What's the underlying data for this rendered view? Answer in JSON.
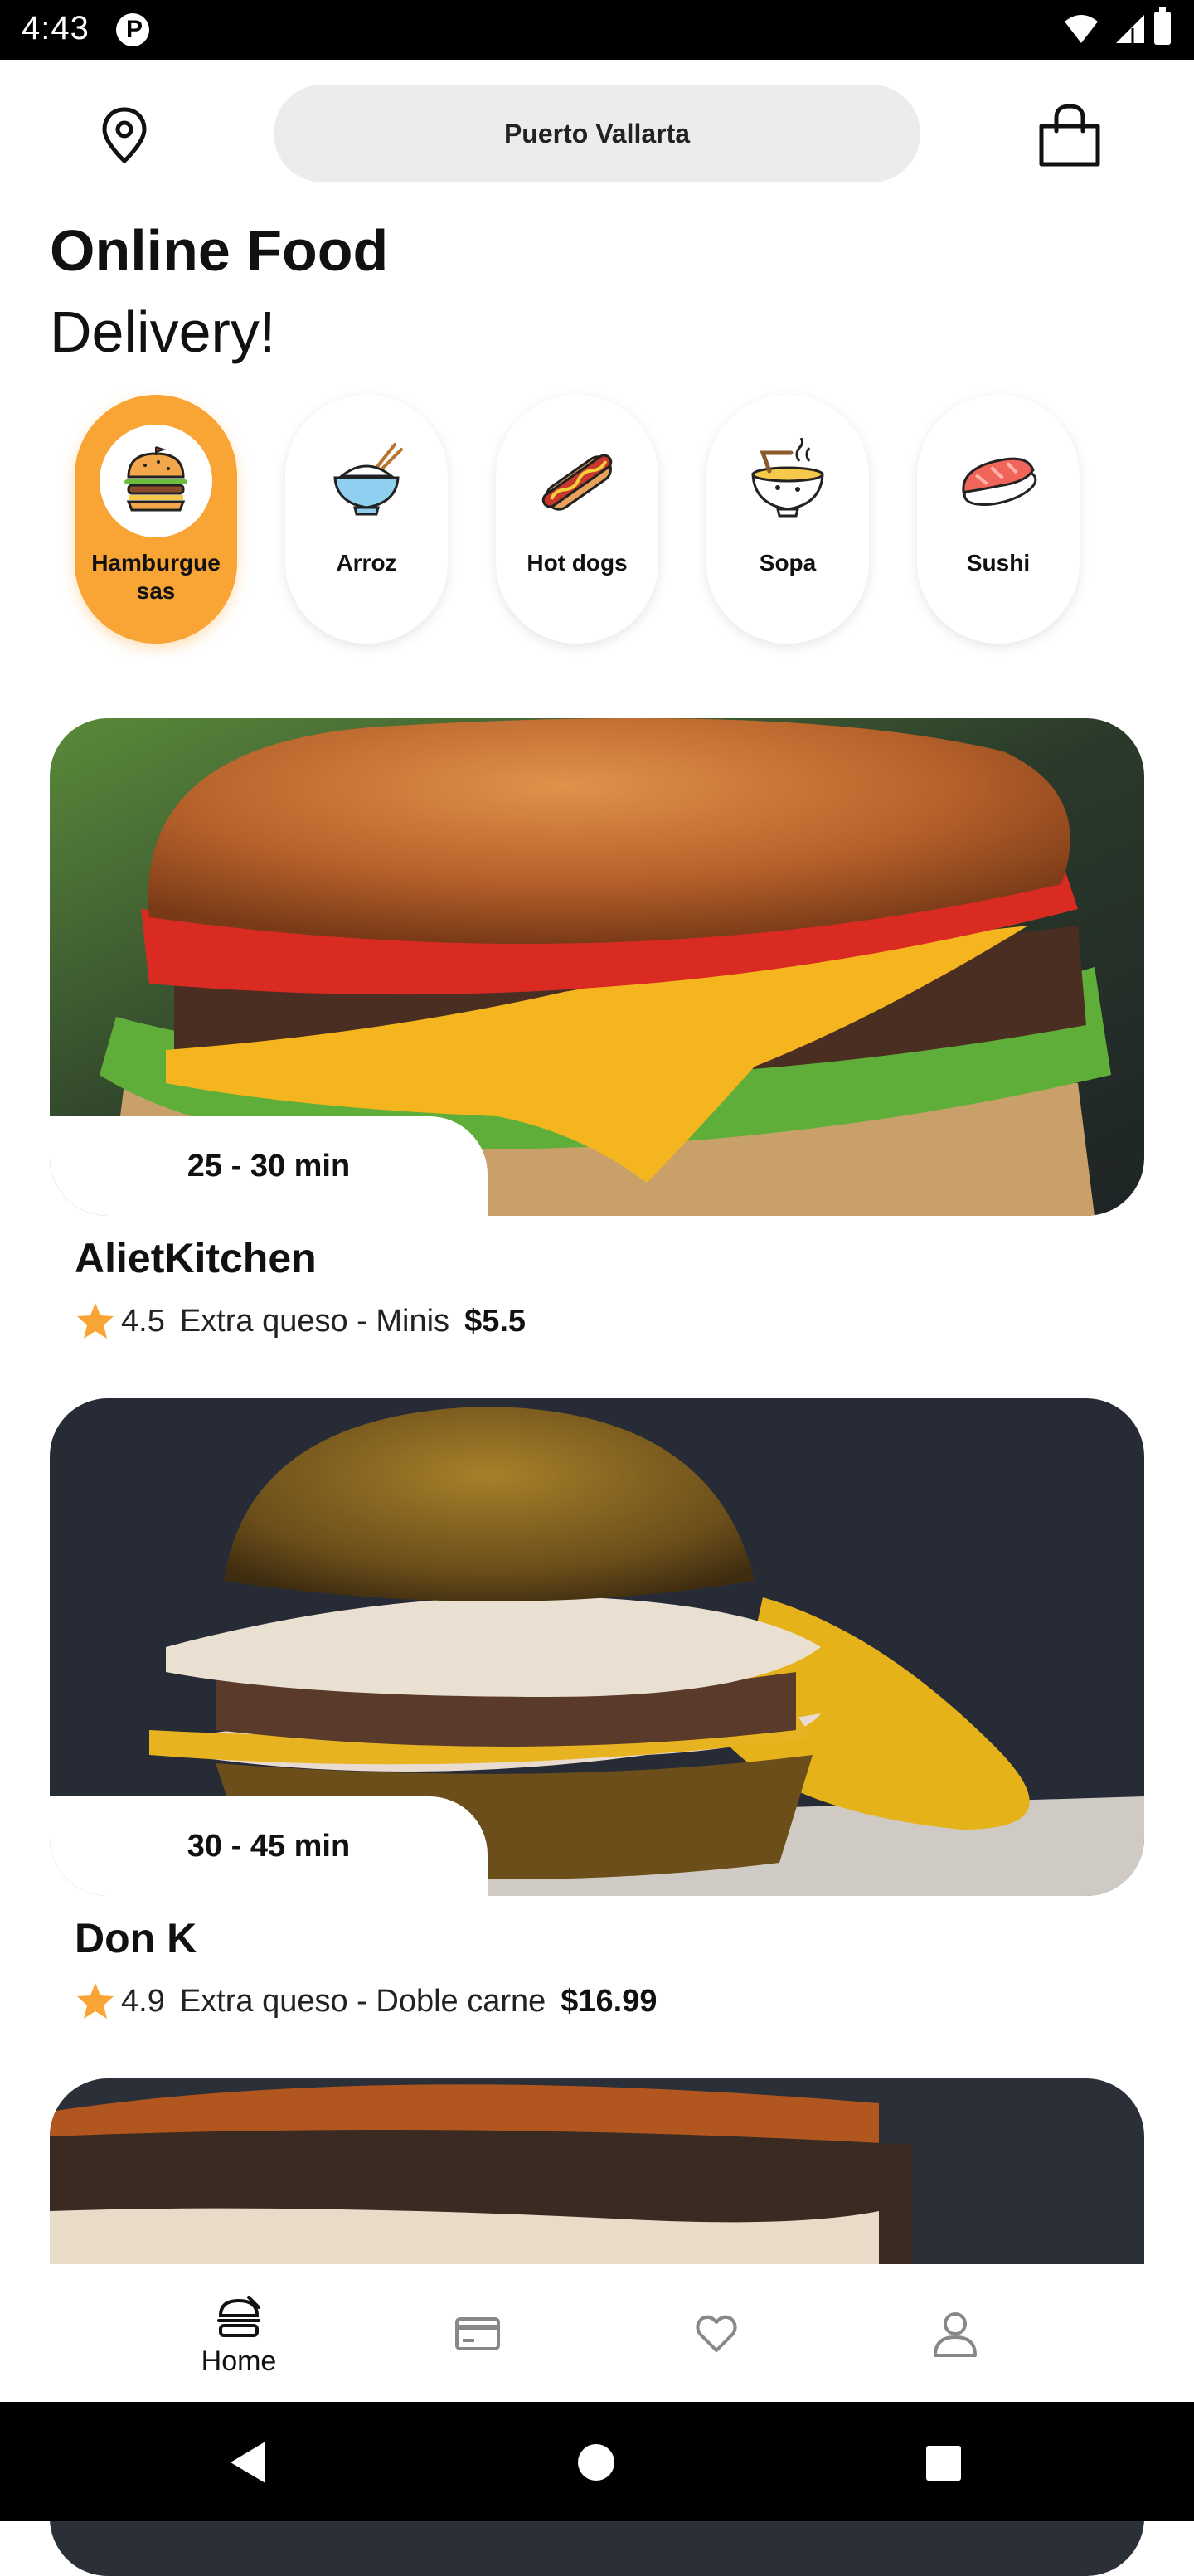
{
  "status_bar": {
    "time": "4:43",
    "app_icon_letter": "P"
  },
  "header": {
    "location": "Puerto Vallarta",
    "location_icon": "map-pin-icon",
    "cart_icon": "shopping-bag-icon"
  },
  "title": {
    "line1": "Online Food",
    "line2": "Delivery!"
  },
  "categories": [
    {
      "label": "Hamburguesas",
      "icon": "burger-icon",
      "active": true
    },
    {
      "label": "Arroz",
      "icon": "rice-bowl-icon",
      "active": false
    },
    {
      "label": "Hot dogs",
      "icon": "hot-dog-icon",
      "active": false
    },
    {
      "label": "Sopa",
      "icon": "soup-bowl-icon",
      "active": false
    },
    {
      "label": "Sushi",
      "icon": "sushi-icon",
      "active": false
    }
  ],
  "restaurants": [
    {
      "time": "25 - 30 min",
      "name": "AlietKitchen",
      "rating": "4.5",
      "description": "Extra queso - Minis",
      "price": "$5.5"
    },
    {
      "time": "30 - 45 min",
      "name": "Don K",
      "rating": "4.9",
      "description": "Extra queso - Doble carne",
      "price": "$16.99"
    }
  ],
  "bottom_nav": {
    "home_label": "Home",
    "items": [
      "home-icon",
      "card-icon",
      "heart-icon",
      "user-icon"
    ]
  },
  "colors": {
    "accent": "#f9a535",
    "pill_bg": "#ececee",
    "star": "#f9a535"
  }
}
